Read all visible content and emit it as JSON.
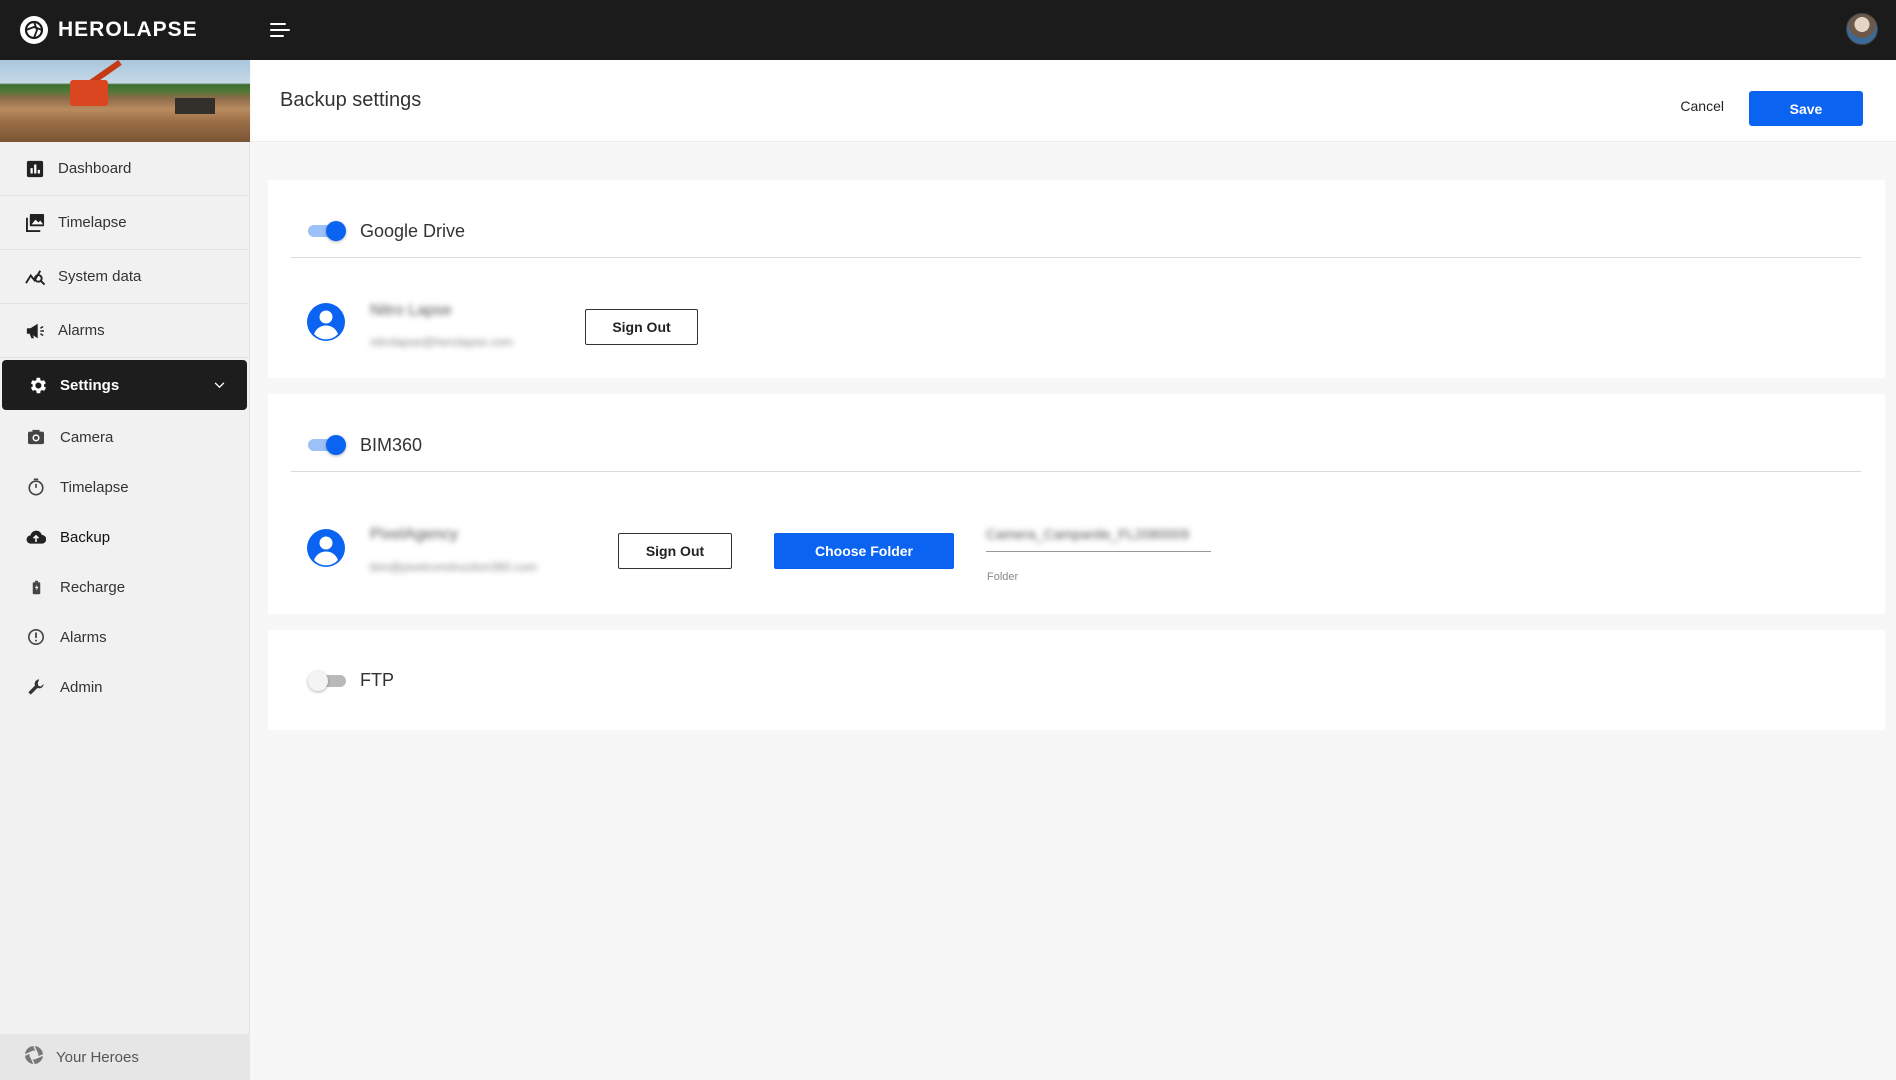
{
  "app": {
    "name": "HEROLAPSE"
  },
  "sidebar": {
    "items": [
      {
        "label": "Dashboard",
        "icon": "dashboard-icon"
      },
      {
        "label": "Timelapse",
        "icon": "images-icon"
      },
      {
        "label": "System data",
        "icon": "chart-search-icon"
      },
      {
        "label": "Alarms",
        "icon": "megaphone-icon"
      },
      {
        "label": "Settings",
        "icon": "gear-icon"
      }
    ],
    "settings_sub": [
      {
        "label": "Camera",
        "icon": "camera-icon"
      },
      {
        "label": "Timelapse",
        "icon": "timer-icon"
      },
      {
        "label": "Backup",
        "icon": "cloud-upload-icon"
      },
      {
        "label": "Recharge",
        "icon": "battery-icon"
      },
      {
        "label": "Alarms",
        "icon": "alert-circle-icon"
      },
      {
        "label": "Admin",
        "icon": "wrench-icon"
      }
    ],
    "footer_label": "Your Heroes"
  },
  "header": {
    "title": "Backup settings",
    "cancel_label": "Cancel",
    "save_label": "Save"
  },
  "google_drive": {
    "title": "Google Drive",
    "enabled": true,
    "account_name": "Nitro Lapse",
    "account_email": "nitrolapse@herolapse.com",
    "sign_out_label": "Sign Out"
  },
  "bim360": {
    "title": "BIM360",
    "enabled": true,
    "account_name": "PixelAgency",
    "account_email": "bim@pixelconstruction360.com",
    "sign_out_label": "Sign Out",
    "choose_folder_label": "Choose Folder",
    "folder_value": "Camera_Campanile_FL2080009",
    "folder_label": "Folder"
  },
  "ftp": {
    "title": "FTP",
    "enabled": false
  },
  "colors": {
    "accent": "#0b63f2",
    "topbar": "#1b1b1b",
    "active_nav": "#1d1d1d"
  }
}
